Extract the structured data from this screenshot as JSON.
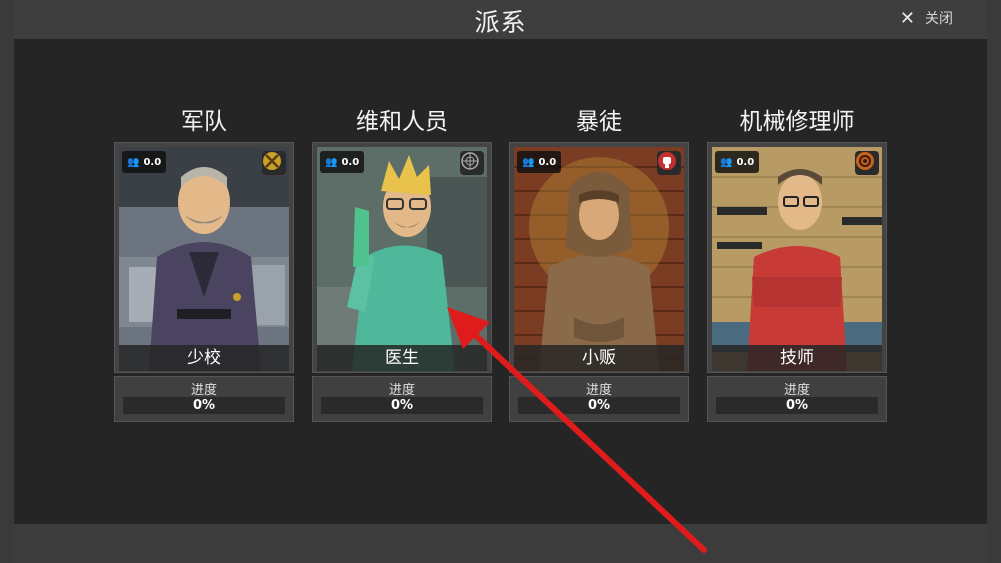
{
  "header": {
    "title": "派系",
    "close_label": "关闭"
  },
  "factions": [
    {
      "name": "军队",
      "role": "少校",
      "score": "0.0",
      "progress_label": "进度",
      "progress_value": "0%",
      "progress": 0,
      "badge_icon": "crossed-swords-icon",
      "badge_color": "#c9a227"
    },
    {
      "name": "维和人员",
      "role": "医生",
      "score": "0.0",
      "progress_label": "进度",
      "progress_value": "0%",
      "progress": 0,
      "badge_icon": "globe-emblem-icon",
      "badge_color": "#8a8a8a"
    },
    {
      "name": "暴徒",
      "role": "小贩",
      "score": "0.0",
      "progress_label": "进度",
      "progress_value": "0%",
      "progress": 0,
      "badge_icon": "raised-fist-icon",
      "badge_color": "#c23030"
    },
    {
      "name": "机械修理师",
      "role": "技师",
      "score": "0.0",
      "progress_label": "进度",
      "progress_value": "0%",
      "progress": 0,
      "badge_icon": "gear-emblem-icon",
      "badge_color": "#c8621f"
    }
  ],
  "annotation": {
    "arrow_color": "#e01b1b"
  }
}
